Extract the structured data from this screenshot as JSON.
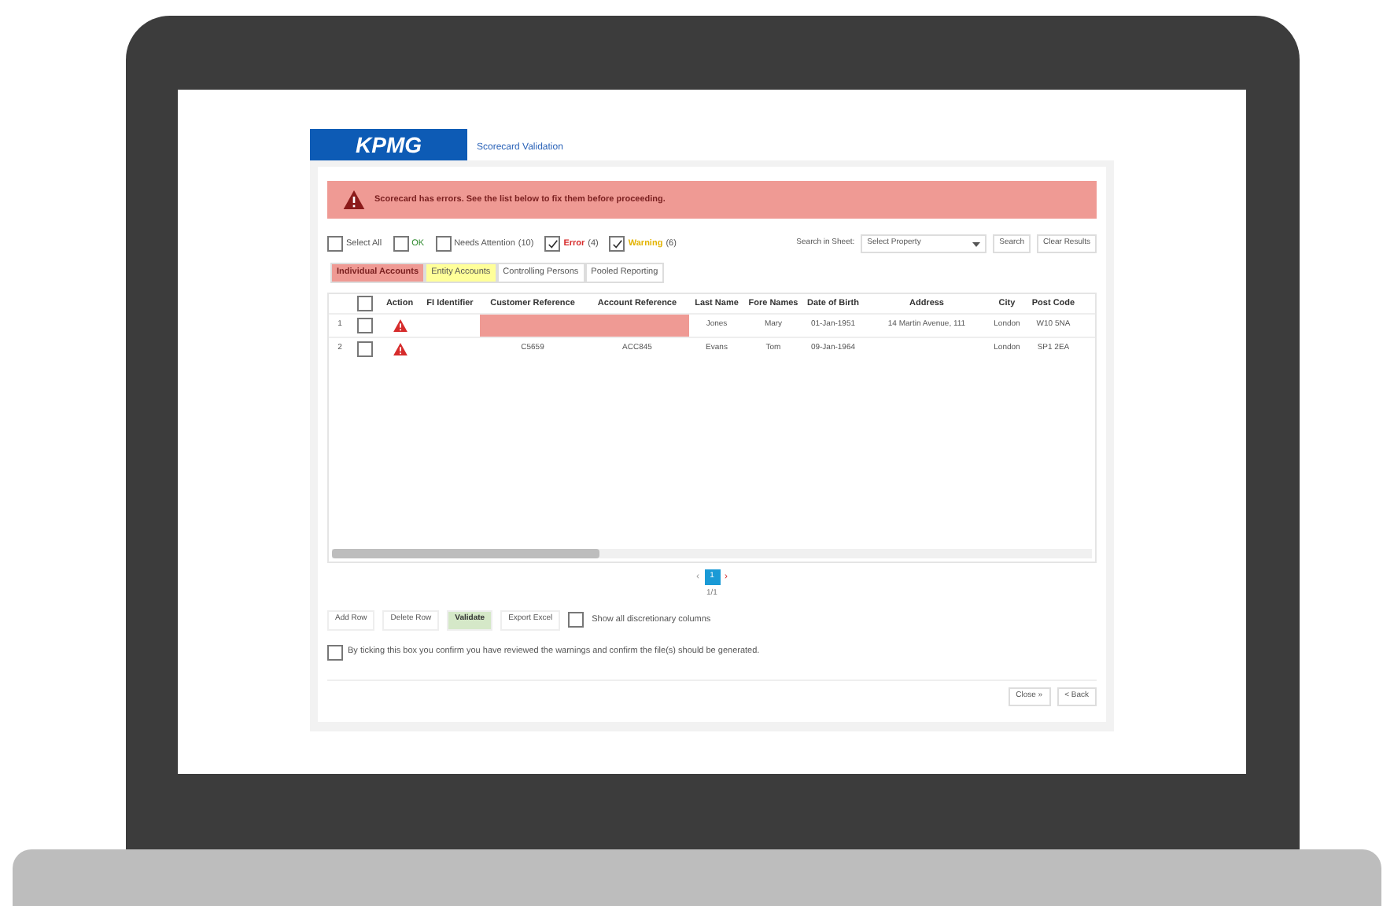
{
  "header": {
    "logo": "KPMG",
    "title": "Scorecard Validation"
  },
  "alert": {
    "message": "Scorecard has errors. See the list below to fix them before proceeding."
  },
  "filters": [
    {
      "kind": "plain",
      "label": "Select All",
      "checked": false
    },
    {
      "kind": "ok",
      "label": "OK",
      "checked": false
    },
    {
      "kind": "plain",
      "label": "Needs Attention",
      "count": "(10)",
      "checked": false
    },
    {
      "kind": "error",
      "label": "Error",
      "count": "(4)",
      "checked": true
    },
    {
      "kind": "warning",
      "label": "Warning",
      "count": "(6)",
      "checked": true
    }
  ],
  "search": {
    "label": "Search in Sheet:",
    "placeholder": "Select Property",
    "buttons": [
      "Search",
      "Clear Results"
    ]
  },
  "tabs": [
    {
      "label": "Individual Accounts",
      "selected": true,
      "color": "#ef9a94"
    },
    {
      "label": "Entity Accounts",
      "selected": false,
      "color": "#ffff99"
    },
    {
      "label": "Controlling Persons",
      "selected": false,
      "color": "#ffffff"
    },
    {
      "label": "Pooled Reporting",
      "selected": false,
      "color": "#ffffff"
    }
  ],
  "table": {
    "select_all_checked": false,
    "action_column": "Action",
    "columns": [
      "FI Identifier",
      "Customer Reference",
      "Account Reference",
      "Last Name",
      "Fore Names",
      "Date of Birth",
      "Address",
      "City",
      "Post Code"
    ],
    "rows": [
      {
        "index": "1",
        "checked": false,
        "cells": [
          {
            "text": "",
            "error": false
          },
          {
            "text": "",
            "error": true
          },
          {
            "text": "",
            "error": true
          },
          {
            "text": "Jones",
            "error": false
          },
          {
            "text": "Mary",
            "error": false
          },
          {
            "text": "01-Jan-1951",
            "error": false
          },
          {
            "text": "14 Martin Avenue, 111",
            "error": false
          },
          {
            "text": "London",
            "error": false
          },
          {
            "text": "W10 5NA",
            "error": false
          }
        ]
      },
      {
        "index": "2",
        "checked": false,
        "cells": [
          {
            "text": "",
            "error": false
          },
          {
            "text": "C5659",
            "error": false
          },
          {
            "text": "ACC845",
            "error": false
          },
          {
            "text": "Evans",
            "error": false
          },
          {
            "text": "Tom",
            "error": false
          },
          {
            "text": "09-Jan-1964",
            "error": false
          },
          {
            "text": "",
            "error": false
          },
          {
            "text": "London",
            "error": false
          },
          {
            "text": "SP1 2EA",
            "error": false
          }
        ]
      }
    ]
  },
  "pagination": {
    "prev": "‹",
    "page": "1",
    "next": "›",
    "summary": "1/1"
  },
  "actions": [
    {
      "label": "Add Row",
      "kind": "plain"
    },
    {
      "label": "Delete Row",
      "kind": "plain"
    },
    {
      "label": "Validate",
      "kind": "primary"
    },
    {
      "label": "Export Excel",
      "kind": "plain"
    }
  ],
  "discretionary": {
    "label": "Show all discretionary columns",
    "checked": false
  },
  "confirm": {
    "label": "By ticking this box you confirm you have reviewed the warnings and confirm the file(s) should be generated.",
    "checked": false
  },
  "nav_buttons": [
    "Close »",
    "< Back"
  ]
}
